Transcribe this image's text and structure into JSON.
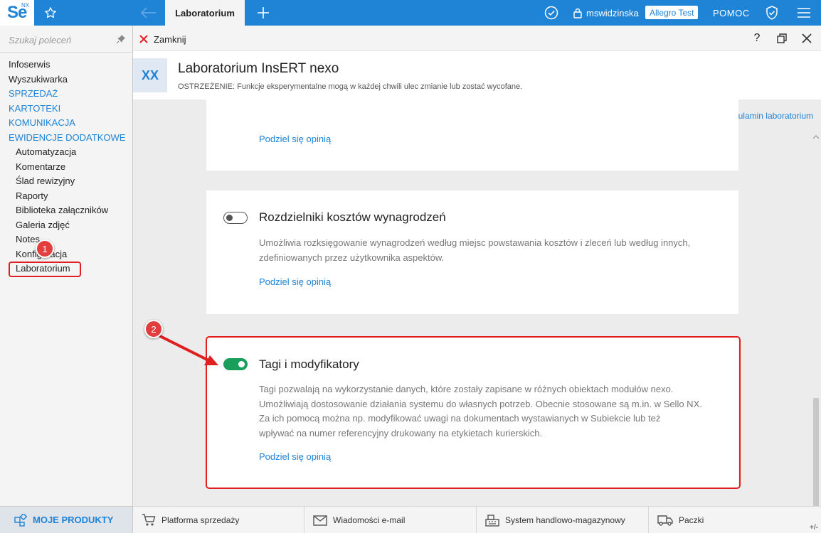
{
  "app": {
    "logo_text": "Se",
    "logo_sup": "NX",
    "active_tab": "Laboratorium",
    "username": "mswidzinska",
    "environment_badge": "Allegro Test",
    "help_label": "POMOC"
  },
  "sidebar": {
    "search_placeholder": "Szukaj poleceń",
    "items": [
      {
        "label": "Infoserwis",
        "kind": "item"
      },
      {
        "label": "Wyszukiwarka",
        "kind": "item"
      },
      {
        "label": "SPRZEDAŻ",
        "kind": "section"
      },
      {
        "label": "KARTOTEKI",
        "kind": "section"
      },
      {
        "label": "KOMUNIKACJA",
        "kind": "section"
      },
      {
        "label": "EWIDENCJE DODATKOWE",
        "kind": "section"
      },
      {
        "label": "Automatyzacja",
        "kind": "sub"
      },
      {
        "label": "Komentarze",
        "kind": "sub"
      },
      {
        "label": "Ślad rewizyjny",
        "kind": "sub"
      },
      {
        "label": "Raporty",
        "kind": "sub"
      },
      {
        "label": "Biblioteka załączników",
        "kind": "sub"
      },
      {
        "label": "Galeria zdjęć",
        "kind": "sub"
      },
      {
        "label": "Notes",
        "kind": "sub"
      },
      {
        "label": "Konfiguracja",
        "kind": "sub"
      },
      {
        "label": "Laboratorium",
        "kind": "selected"
      }
    ],
    "my_products_label": "MOJE PRODUKTY"
  },
  "window": {
    "close_label": "Zamknij",
    "help_btn": "?"
  },
  "header": {
    "icon_text": "XX",
    "title": "Laboratorium InsERT nexo",
    "subtitle": "OSTRZEŻENIE: Funkcje eksperymentalne mogą w każdej chwili ulec zmianie lub zostać wycofane."
  },
  "content": {
    "rules_link": "Regulamin laboratorium",
    "card_top": {
      "link": "Podziel się opinią"
    },
    "card_costs": {
      "title": "Rozdzielniki kosztów wynagrodzeń",
      "enabled": false,
      "desc_lines": [
        "Umożliwia rozksięgowanie wynagrodzeń według miejsc powstawania kosztów i zleceń lub według innych,",
        "zdefiniowanych przez użytkownika aspektów."
      ],
      "link": "Podziel się opinią"
    },
    "card_tags": {
      "title": "Tagi i modyfikatory",
      "enabled": true,
      "desc_lines": [
        "Tagi pozwalają na wykorzystanie danych, które zostały zapisane w różnych obiektach modułów nexo.",
        "Umożliwiają dostosowanie działania systemu do własnych potrzeb. Obecnie stosowane są m.in. w Sello NX.",
        "Za ich pomocą można np. modyfikować uwagi na dokumentach wystawianych w Subiekcie lub też",
        "wpływać na numer referencyjny drukowany na etykietach kurierskich."
      ],
      "link": "Podziel się opinią"
    }
  },
  "markers": {
    "m1": "1",
    "m2": "2"
  },
  "bottombar": {
    "items": [
      {
        "label": "Platforma sprzedaży",
        "icon": "cart-icon"
      },
      {
        "label": "Wiadomości e-mail",
        "icon": "mail-icon"
      },
      {
        "label": "System handlowo-magazynowy",
        "icon": "cash-register-icon"
      },
      {
        "label": "Paczki",
        "icon": "truck-icon"
      }
    ],
    "plusminus": "+/-"
  },
  "colors": {
    "accent": "#1f83d6",
    "toggle_on": "#1a9e5b",
    "highlight_red": "#e02020"
  }
}
